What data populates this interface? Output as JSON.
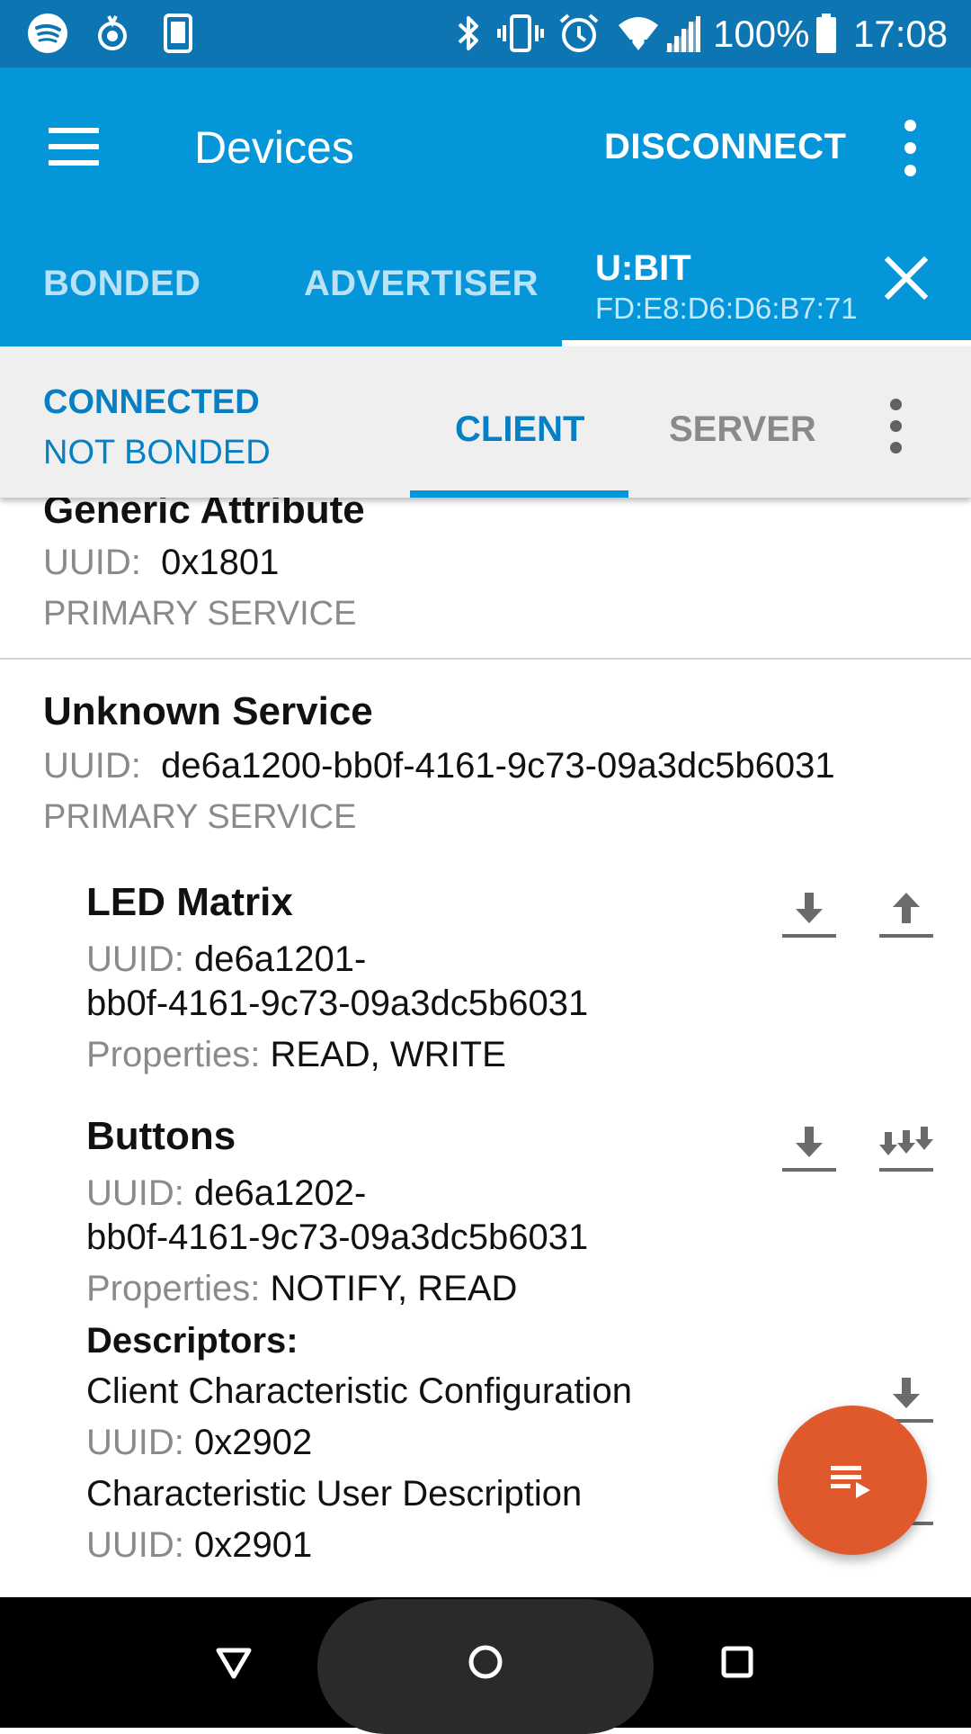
{
  "status_bar": {
    "icons": [
      "spotify-icon",
      "location-app-icon",
      "phone-app-icon",
      "bluetooth-icon",
      "vibrate-icon",
      "alarm-icon",
      "wifi-icon",
      "signal-icon",
      "battery-icon"
    ],
    "battery": "100%",
    "time": "17:08"
  },
  "app_bar": {
    "title": "Devices",
    "disconnect_label": "DISCONNECT"
  },
  "device_tabs": {
    "bonded": "BONDED",
    "advertiser": "ADVERTISER",
    "active_name": "U:BIT",
    "active_address": "FD:E8:D6:D6:B7:71"
  },
  "connection": {
    "state": "CONNECTED",
    "bond": "NOT BONDED",
    "tab_client": "CLIENT",
    "tab_server": "SERVER"
  },
  "services": [
    {
      "name": "Generic Attribute",
      "uuid_label": "UUID:",
      "uuid": "0x1801",
      "type": "PRIMARY SERVICE"
    },
    {
      "name": "Unknown Service",
      "uuid_label": "UUID:",
      "uuid": "de6a1200-bb0f-4161-9c73-09a3dc5b6031",
      "type": "PRIMARY SERVICE"
    }
  ],
  "characteristics": [
    {
      "name": "LED Matrix",
      "uuid_label": "UUID:",
      "uuid_line1": "de6a1201-",
      "uuid_line2": "bb0f-4161-9c73-09a3dc5b6031",
      "props_label": "Properties:",
      "props": "READ, WRITE"
    },
    {
      "name": "Buttons",
      "uuid_label": "UUID:",
      "uuid_line1": "de6a1202-",
      "uuid_line2": "bb0f-4161-9c73-09a3dc5b6031",
      "props_label": "Properties:",
      "props": "NOTIFY, READ",
      "descriptors_label": "Descriptors:",
      "descriptors": [
        {
          "name": "Client Characteristic Configuration",
          "uuid_label": "UUID:",
          "uuid": "0x2902"
        },
        {
          "name": "Characteristic User Description",
          "uuid_label": "UUID:",
          "uuid": "0x2901"
        }
      ]
    }
  ],
  "colors": {
    "status_bar": "#0d75b2",
    "app_bar": "#0596d9",
    "accent_text": "#0680c3",
    "fab": "#e0592c",
    "nav_bar": "#000000"
  }
}
